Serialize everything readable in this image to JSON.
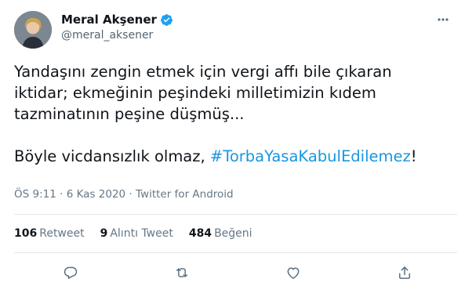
{
  "author": {
    "name": "Meral Akşener",
    "handle": "@meral_aksener"
  },
  "tweet": {
    "lines": [
      "Yandaşını zengin etmek için vergi affı bile çıkaran",
      "iktidar; ekmeğinin peşindeki milletimizin kıdem",
      "tazminatının peşine düşmüş..."
    ],
    "second_prefix": "Böyle vicdansızlık olmaz, ",
    "hashtag": "#TorbaYasaKabulEdilemez",
    "second_suffix": "!"
  },
  "meta": {
    "time": "ÖS 9:11",
    "sep1": " · ",
    "date": "6 Kas 2020",
    "sep2": " · ",
    "source": "Twitter for Android"
  },
  "stats": {
    "retweets": {
      "count": "106",
      "label": "Retweet"
    },
    "quotes": {
      "count": "9",
      "label": "Alıntı Tweet"
    },
    "likes": {
      "count": "484",
      "label": "Beğeni"
    }
  },
  "icons": {
    "verified": "verified-badge-icon",
    "more": "more-options-icon",
    "reply": "reply-icon",
    "retweet": "retweet-icon",
    "like": "like-icon",
    "share": "share-icon"
  },
  "colors": {
    "text": "#0f1419",
    "secondary": "#657786",
    "hashtag": "#1b95e0",
    "verified": "#1da1f2",
    "divider": "#e1e8ed",
    "action_icon": "#5b7083"
  }
}
